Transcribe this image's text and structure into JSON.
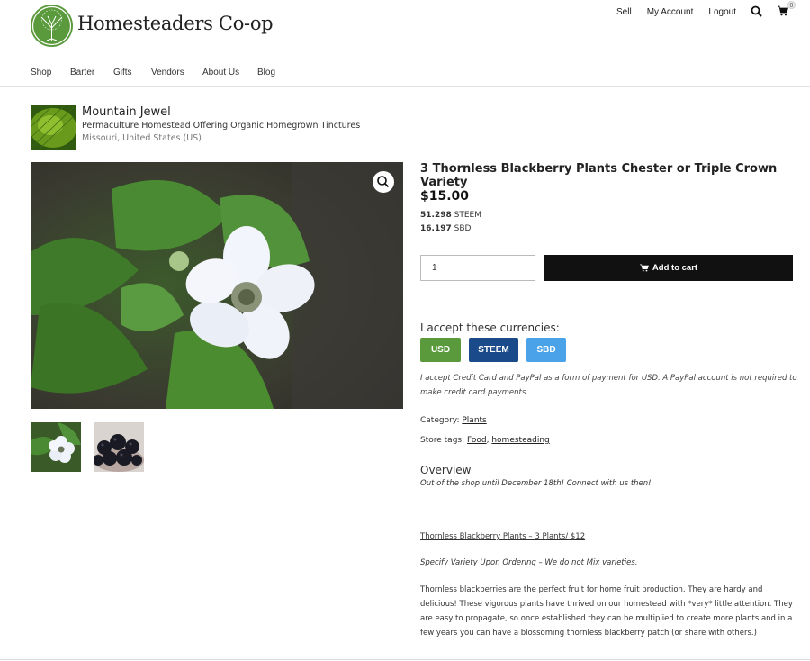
{
  "site": {
    "name": "Homesteaders Co-op"
  },
  "top_links": {
    "sell": "Sell",
    "account": "My Account",
    "logout": "Logout",
    "cart_count": "0"
  },
  "nav": [
    "Shop",
    "Barter",
    "Gifts",
    "Vendors",
    "About Us",
    "Blog"
  ],
  "vendor": {
    "name": "Mountain Jewel",
    "tagline": "Permaculture Homestead Offering Organic Homegrown Tinctures",
    "location": "Missouri, United States (US)"
  },
  "product": {
    "title": "3 Thornless Blackberry Plants Chester or Triple Crown Variety",
    "price": "$15.00",
    "steem_amount": "51.298",
    "steem_unit": "STEEM",
    "sbd_amount": "16.197",
    "sbd_unit": "SBD",
    "quantity": "1",
    "add_to_cart": "Add to cart"
  },
  "currencies": {
    "label": "I accept these currencies:",
    "buttons": [
      {
        "label": "USD",
        "color": "#5a9a3c"
      },
      {
        "label": "STEEM",
        "color": "#1a4a8a"
      },
      {
        "label": "SBD",
        "color": "#4aa3e8"
      }
    ],
    "note": "I accept Credit Card and PayPal as a form of payment for USD. A PayPal account is not required to make credit card payments."
  },
  "meta": {
    "category_label": "Category:",
    "category": "Plants",
    "tags_label": "Store tags:",
    "tag1": "Food",
    "tag2": "homesteading"
  },
  "overview": {
    "title": "Overview",
    "notice": "Out of the shop until December 18th! Connect with us then!",
    "heading": "Thornless Blackberry Plants – 3 Plants/ $12",
    "specify": "Specify Variety Upon Ordering – We do not Mix varieties.",
    "body": "Thornless blackberries are the perfect fruit for home fruit production. They are hardy and delicious! These vigorous plants have thrived on our homestead with *very* little attention. They are easy to propagate, so once established they can be multiplied to create more plants and in a few years you can have a blossoming thornless blackberry patch (or share with others.)"
  },
  "icons": {
    "search": "search-icon",
    "cart": "cart-icon",
    "zoom": "zoom-icon"
  },
  "colors": {
    "brand_green": "#5a9a3c",
    "cart_button": "#111111"
  }
}
